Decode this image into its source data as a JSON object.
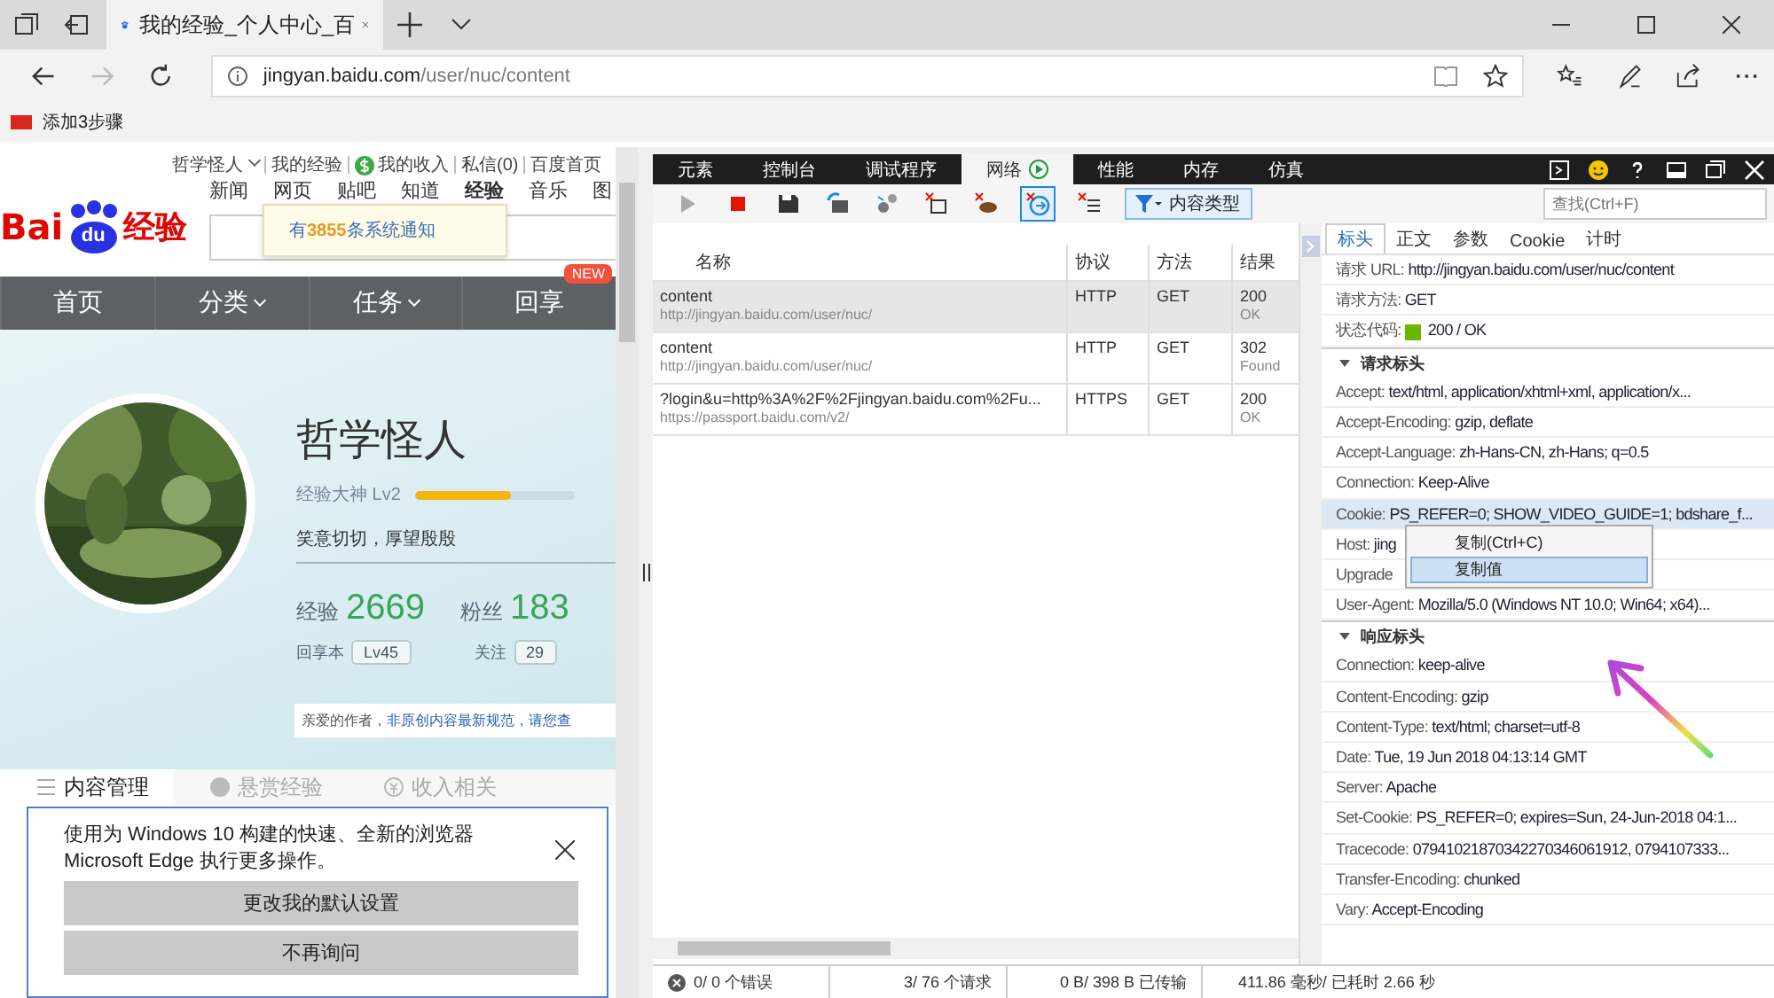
{
  "browser": {
    "tabs": [
      {
        "title": "我的经验_个人中心_百",
        "selected": true
      }
    ],
    "nav_buttons": [
      {
        "kind": "back",
        "disabled": false
      },
      {
        "kind": "forward",
        "disabled": true
      },
      {
        "kind": "refresh",
        "disabled": false
      }
    ],
    "address": {
      "host": "jingyan.baidu.com",
      "path": "/user/nuc/content"
    },
    "favorites": [
      "添加3步骤"
    ]
  },
  "page": {
    "top_links": [
      {
        "label": "哲学怪人",
        "kind": "user"
      },
      {
        "label": "我的经验",
        "kind": "link"
      },
      {
        "label": "我的收入",
        "kind": "income"
      },
      {
        "label": "私信(0)",
        "kind": "link"
      },
      {
        "label": "百度首页",
        "kind": "link"
      }
    ],
    "nav_links": [
      {
        "label": "新闻",
        "selected": false
      },
      {
        "label": "网页",
        "selected": false
      },
      {
        "label": "贴吧",
        "selected": false
      },
      {
        "label": "知道",
        "selected": false
      },
      {
        "label": "经验",
        "selected": true
      },
      {
        "label": "音乐",
        "selected": false
      },
      {
        "label": "图",
        "selected": false
      }
    ],
    "logo": {
      "left": "Bai",
      "paw": "du",
      "right": "经验"
    },
    "notice": {
      "prefix": "有",
      "count": "3855",
      "suffix": "条系统通知"
    },
    "main_nav": [
      {
        "label": "首页",
        "dropdown": false
      },
      {
        "label": "分类",
        "dropdown": true
      },
      {
        "label": "任务",
        "dropdown": true
      },
      {
        "label": "回享",
        "dropdown": false,
        "badge": "NEW"
      }
    ],
    "profile": {
      "name": "哲学怪人",
      "rank": "经验大神 Lv2",
      "level": 0.6,
      "motto": "笑意切切，厚望殷殷",
      "stats": [
        {
          "label": "经验",
          "value": "2669"
        },
        {
          "label": "粉丝",
          "value": "183"
        }
      ],
      "sub_stats": [
        {
          "label": "回享本",
          "value": "Lv45"
        },
        {
          "label": "关注",
          "value": "29"
        }
      ],
      "announcement": {
        "text": "亲爱的作者，",
        "link": "非原创内容最新规范，请您查"
      }
    },
    "content_tabs": [
      {
        "label": "内容管理",
        "selected": true
      },
      {
        "label": "悬赏经验",
        "selected": false
      },
      {
        "label": "收入相关",
        "selected": false
      }
    ],
    "edge_prompt": {
      "message": "使用为 Windows 10 构建的快速、全新的浏览器 Microsoft Edge 执行更多操作。",
      "buttons": [
        "更改我的默认设置",
        "不再询问"
      ]
    }
  },
  "devtools": {
    "tabs": [
      {
        "label": "元素",
        "selected": false
      },
      {
        "label": "控制台",
        "selected": false
      },
      {
        "label": "调试程序",
        "selected": false
      },
      {
        "label": "网络",
        "selected": true
      },
      {
        "label": "性能",
        "selected": false
      },
      {
        "label": "内存",
        "selected": false
      },
      {
        "label": "仿真",
        "selected": false
      }
    ],
    "filter": "内容类型",
    "search": {
      "placeholder": "查找(Ctrl+F)"
    },
    "columns": [
      "名称",
      "协议",
      "方法",
      "结果"
    ],
    "requests": [
      {
        "name": "content",
        "url": "http://jingyan.baidu.com/user/nuc/",
        "protocol": "HTTP",
        "method": "GET",
        "status": "200",
        "status_text": "OK",
        "selected": true
      },
      {
        "name": "content",
        "url": "http://jingyan.baidu.com/user/nuc/",
        "protocol": "HTTP",
        "method": "GET",
        "status": "302",
        "status_text": "Found",
        "selected": false
      },
      {
        "name": "?login&u=http%3A%2F%2Fjingyan.baidu.com%2Fu...",
        "url": "https://passport.baidu.com/v2/",
        "protocol": "HTTPS",
        "method": "GET",
        "status": "200",
        "status_text": "OK",
        "selected": false
      }
    ],
    "status_bar": [
      "0/ 0 个错误",
      "3/ 76 个请求",
      "0 B/ 398 B 已传输",
      "411.86 毫秒/ 已耗时 2.66 秒"
    ],
    "detail_tabs": [
      {
        "label": "标头",
        "selected": true
      },
      {
        "label": "正文",
        "selected": false
      },
      {
        "label": "参数",
        "selected": false
      },
      {
        "label": "Cookie",
        "selected": false
      },
      {
        "label": "计时",
        "selected": false
      }
    ],
    "general": [
      {
        "name": "请求 URL:",
        "value": "http://jingyan.baidu.com/user/nuc/content",
        "kind": "text"
      },
      {
        "name": "请求方法:",
        "value": "GET",
        "kind": "text"
      },
      {
        "name": "状态代码:",
        "value": "200 / OK",
        "kind": "status",
        "color": "#6bb700"
      }
    ],
    "sections": [
      {
        "title": "请求标头",
        "expanded": true,
        "headers": [
          {
            "name": "Accept:",
            "value": "text/html, application/xhtml+xml, application/x...",
            "selected": false
          },
          {
            "name": "Accept-Encoding:",
            "value": "gzip, deflate",
            "selected": false
          },
          {
            "name": "Accept-Language:",
            "value": "zh-Hans-CN, zh-Hans; q=0.5",
            "selected": false
          },
          {
            "name": "Connection:",
            "value": "Keep-Alive",
            "selected": false
          },
          {
            "name": "Cookie:",
            "value": "PS_REFER=0; SHOW_VIDEO_GUIDE=1; bdshare_f...",
            "selected": true
          },
          {
            "name": "Host:",
            "value": "jing",
            "selected": false
          },
          {
            "name": "Upgrade",
            "selected": false
          },
          {
            "name": "User-Agent:",
            "value": "Mozilla/5.0 (Windows NT 10.0; Win64; x64)...",
            "selected": false
          }
        ]
      },
      {
        "title": "响应标头",
        "expanded": true,
        "headers": [
          {
            "name": "Connection:",
            "value": "keep-alive",
            "selected": false
          },
          {
            "name": "Content-Encoding:",
            "value": "gzip",
            "selected": false
          },
          {
            "name": "Content-Type:",
            "value": "text/html; charset=utf-8",
            "selected": false
          },
          {
            "name": "Date:",
            "value": "Tue, 19 Jun 2018 04:13:14 GMT",
            "selected": false
          },
          {
            "name": "Server:",
            "value": "Apache",
            "selected": false
          },
          {
            "name": "Set-Cookie:",
            "value": "PS_REFER=0; expires=Sun, 24-Jun-2018 04:1...",
            "selected": false
          },
          {
            "name": "Tracecode:",
            "value": "07941021870342270346061912, 0794107333...",
            "selected": false
          },
          {
            "name": "Transfer-Encoding:",
            "value": "chunked",
            "selected": false
          },
          {
            "name": "Vary:",
            "value": "Accept-Encoding",
            "selected": false
          }
        ]
      }
    ],
    "context_menu": [
      {
        "label": "复制(Ctrl+C)",
        "selected": false
      },
      {
        "label": "复制值",
        "selected": true
      }
    ]
  }
}
